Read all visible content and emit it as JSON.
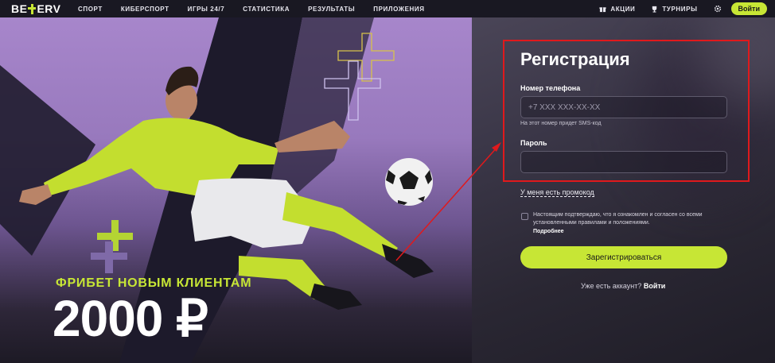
{
  "header": {
    "logo_text_left": "BE",
    "logo_text_right": "ERV",
    "nav": [
      "СПОРТ",
      "КИБЕРСПОРТ",
      "ИГРЫ 24/7",
      "СТАТИСТИКА",
      "РЕЗУЛЬТАТЫ",
      "ПРИЛОЖЕНИЯ"
    ],
    "promos_label": "АКЦИИ",
    "tournaments_label": "ТУРНИРЫ",
    "login_label": "Войти"
  },
  "hero": {
    "subtitle": "ФРИБЕТ НОВЫМ КЛИЕНТАМ",
    "amount": "2000 ₽"
  },
  "registration": {
    "title": "Регистрация",
    "phone_label": "Номер телефона",
    "phone_placeholder": "+7 XXX XXX-XX-XX",
    "phone_hint": "На этот номер придет SMS-код",
    "password_label": "Пароль",
    "password_value": "",
    "promo_code_link": "У меня есть промокод",
    "terms_text": "Настоящим подтверждаю, что я ознакомлен и согласен со всеми установленными правилами и положениями.",
    "terms_more": "Подробнее",
    "submit_label": "Зарегистрироваться",
    "have_account_text": "Уже есть аккаунт?",
    "have_account_link": "Войти"
  },
  "colors": {
    "accent": "#c7e635",
    "highlight_box": "#e0191c",
    "hero_bg": "#a786cb",
    "panel_bg": "#2a2733"
  }
}
